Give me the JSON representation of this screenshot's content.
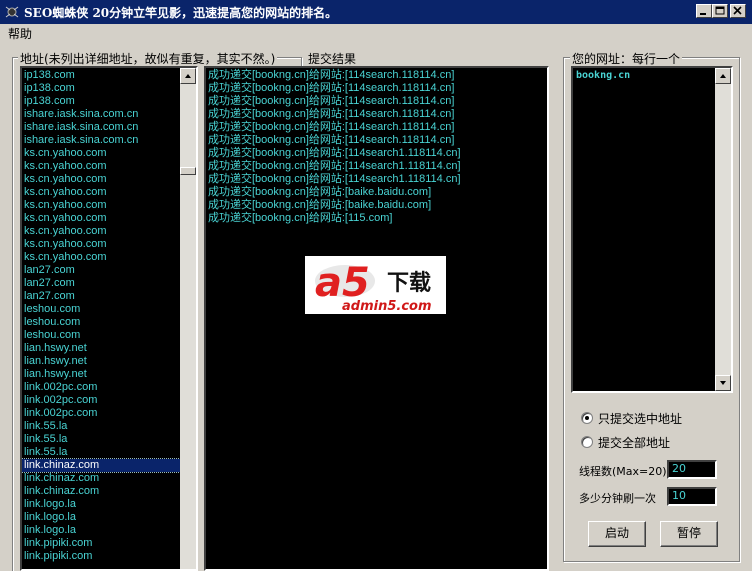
{
  "window": {
    "title": "SEO蜘蛛侠   20分钟立竿见影，迅速提高您的网站的排名。",
    "icon": "spider-app-icon",
    "controls": [
      "minimize",
      "maximize",
      "close"
    ]
  },
  "menu": {
    "help": "帮助"
  },
  "left_panel": {
    "label": "地址(未列出详细地址，故似有重复，其实不然。)",
    "items": [
      "ip138.com",
      "ip138.com",
      "ip138.com",
      "ishare.iask.sina.com.cn",
      "ishare.iask.sina.com.cn",
      "ishare.iask.sina.com.cn",
      "ks.cn.yahoo.com",
      "ks.cn.yahoo.com",
      "ks.cn.yahoo.com",
      "ks.cn.yahoo.com",
      "ks.cn.yahoo.com",
      "ks.cn.yahoo.com",
      "ks.cn.yahoo.com",
      "ks.cn.yahoo.com",
      "ks.cn.yahoo.com",
      "lan27.com",
      "lan27.com",
      "lan27.com",
      "leshou.com",
      "leshou.com",
      "leshou.com",
      "lian.hswy.net",
      "lian.hswy.net",
      "lian.hswy.net",
      "link.002pc.com",
      "link.002pc.com",
      "link.002pc.com",
      "link.55.la",
      "link.55.la",
      "link.55.la",
      "link.chinaz.com",
      "link.chinaz.com",
      "link.chinaz.com",
      "link.logo.la",
      "link.logo.la",
      "link.logo.la",
      "link.pipiki.com",
      "link.pipiki.com"
    ],
    "selected_index": 30
  },
  "result_panel": {
    "label": "提交结果",
    "lines": [
      "成功递交[bookng.cn]给网站:[114search.118114.cn]",
      "成功递交[bookng.cn]给网站:[114search.118114.cn]",
      "成功递交[bookng.cn]给网站:[114search.118114.cn]",
      "成功递交[bookng.cn]给网站:[114search.118114.cn]",
      "成功递交[bookng.cn]给网站:[114search.118114.cn]",
      "成功递交[bookng.cn]给网站:[114search.118114.cn]",
      "成功递交[bookng.cn]给网站:[114search1.118114.cn]",
      "成功递交[bookng.cn]给网站:[114search1.118114.cn]",
      "成功递交[bookng.cn]给网站:[114search1.118114.cn]",
      "成功递交[bookng.cn]给网站:[baike.baidu.com]",
      "成功递交[bookng.cn]给网站:[baike.baidu.com]",
      "成功递交[bookng.cn]给网站:[115.com]"
    ]
  },
  "watermark": {
    "logo_text": "a5",
    "sub_text": "下载",
    "url": "admin5.com"
  },
  "right_panel": {
    "label": "您的网址：每行一个",
    "url_text": "bookng.cn",
    "radio_selected": "只提交选中地址",
    "radio_all": "提交全部地址",
    "threads_label": "线程数(Max=20):",
    "threads_value": "20",
    "refresh_label": "多少分钟刷一次",
    "refresh_value": "10",
    "start_button": "启动",
    "pause_button": "暂停"
  },
  "colors": {
    "titlebar": "#0a246a",
    "list_text": "#49d3d3",
    "list_bg": "#000000",
    "face": "#d4d0c8"
  }
}
